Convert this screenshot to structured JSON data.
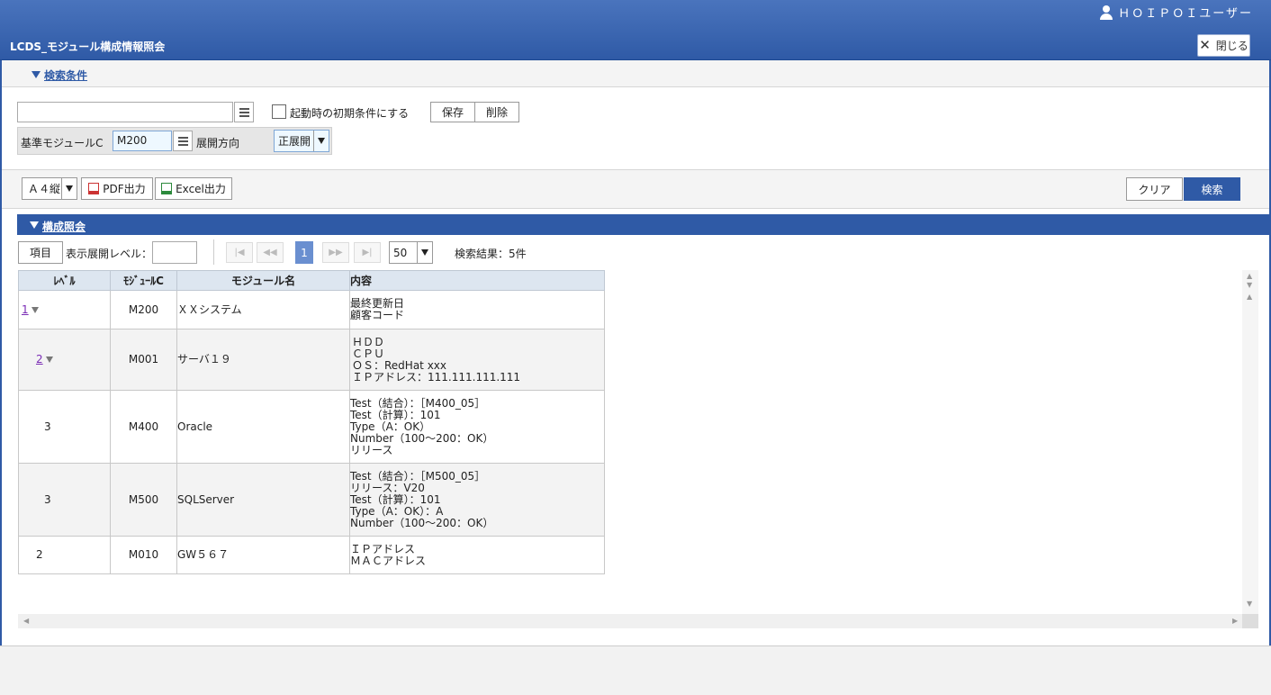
{
  "header": {
    "user_name": "ＨＯＩＰＯＩユーザー",
    "title": "LCDS_モジュール構成情報照会",
    "close_label": "閉じる"
  },
  "search": {
    "section_label": "検索条件",
    "condition_value": "",
    "default_check_label": "起動時の初期条件にする",
    "save_label": "保存",
    "delete_label": "削除",
    "base_module_label": "基準モジュールC",
    "base_module_value": "M200",
    "direction_label": "展開方向",
    "direction_value": "正展開"
  },
  "toolbar": {
    "paper_value": "Ａ４縦",
    "pdf_label": "PDF出力",
    "excel_label": "Excel出力",
    "clear_label": "クリア",
    "search_label": "検索"
  },
  "result": {
    "section_label": "構成照会",
    "items_label": "項目",
    "level_label": "表示展開レベル：",
    "level_value": "",
    "page": "1",
    "page_size": "50",
    "count_text": "検索結果：5件",
    "columns": [
      "ﾚﾍﾞﾙ",
      "ﾓｼﾞｭｰﾙC",
      "モジュール名",
      "内容"
    ],
    "rows": [
      {
        "level": "1",
        "code": "M200",
        "name": "ＸＸシステム",
        "content": [
          "最終更新日",
          "顧客コード"
        ]
      },
      {
        "level": "2",
        "code": "M001",
        "name": "サーバ１９",
        "content": [
          "ＨＤＤ",
          "ＣＰＵ",
          "ＯＳ：RedHat xxx",
          "ＩＰアドレス：111.111.111.111"
        ]
      },
      {
        "level": "3",
        "code": "M400",
        "name": "Oracle",
        "content": [
          "Test（結合）：［M400_05］",
          "Test（計算）：101",
          "Type（A：OK）",
          "Number（100～200：OK）",
          "リリース"
        ]
      },
      {
        "level": "3",
        "code": "M500",
        "name": "SQLServer",
        "content": [
          "Test（結合）：［M500_05］",
          "リリース：V20",
          "Test（計算）：101",
          "Type（A：OK）：A",
          "Number（100～200：OK）"
        ]
      },
      {
        "level": "2",
        "code": "M010",
        "name": "GW５６７",
        "content": [
          "ＩＰアドレス",
          "ＭＡＣアドレス"
        ]
      }
    ]
  },
  "colors": {
    "brand": "#2f5aa6",
    "active_page": "#6a8fd0"
  }
}
